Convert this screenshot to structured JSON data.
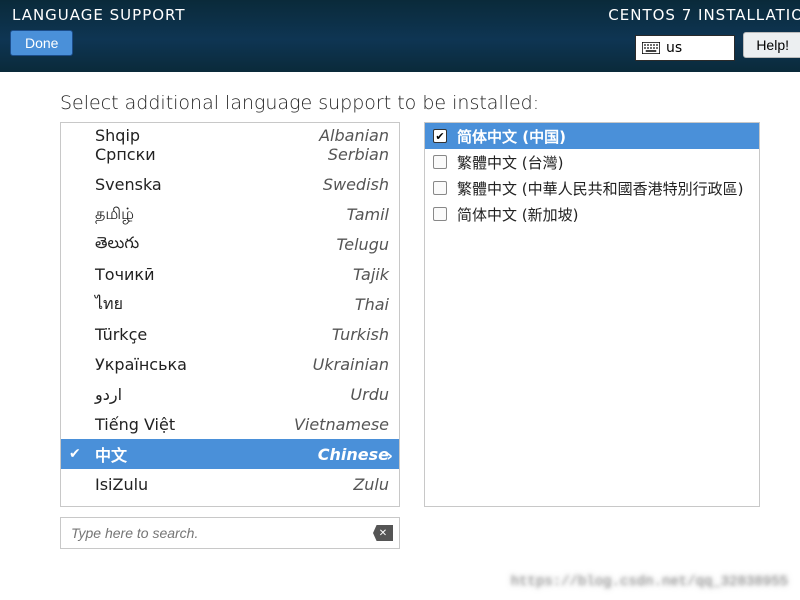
{
  "header": {
    "title_left": "LANGUAGE SUPPORT",
    "title_right": "CENTOS 7 INSTALLATIO",
    "done_label": "Done",
    "help_label": "Help!",
    "keyboard_layout": "us",
    "keyboard_icon": "keyboard-icon"
  },
  "prompt": "Select additional language support to be installed:",
  "search": {
    "placeholder": "Type here to search.",
    "clear_icon": "backspace-clear-icon",
    "value": ""
  },
  "languages_visible": [
    {
      "native": "Shqip",
      "english": "Albanian",
      "selected": false,
      "checked": false,
      "cutoff": true
    },
    {
      "native": "Српски",
      "english": "Serbian",
      "selected": false,
      "checked": false
    },
    {
      "native": "Svenska",
      "english": "Swedish",
      "selected": false,
      "checked": false
    },
    {
      "native": "தமிழ்",
      "english": "Tamil",
      "selected": false,
      "checked": false
    },
    {
      "native": "తెలుగు",
      "english": "Telugu",
      "selected": false,
      "checked": false
    },
    {
      "native": "Точикӣ",
      "english": "Tajik",
      "selected": false,
      "checked": false
    },
    {
      "native": "ไทย",
      "english": "Thai",
      "selected": false,
      "checked": false
    },
    {
      "native": "Türkçe",
      "english": "Turkish",
      "selected": false,
      "checked": false
    },
    {
      "native": "Українська",
      "english": "Ukrainian",
      "selected": false,
      "checked": false
    },
    {
      "native": "اردو",
      "english": "Urdu",
      "selected": false,
      "checked": false
    },
    {
      "native": "Tiếng Việt",
      "english": "Vietnamese",
      "selected": false,
      "checked": false
    },
    {
      "native": "中文",
      "english": "Chinese",
      "selected": true,
      "checked": true
    },
    {
      "native": "IsiZulu",
      "english": "Zulu",
      "selected": false,
      "checked": false
    }
  ],
  "locales": [
    {
      "label": "简体中文 (中国)",
      "checked": true,
      "selected": true
    },
    {
      "label": "繁體中文 (台灣)",
      "checked": false,
      "selected": false
    },
    {
      "label": "繁體中文 (中華人民共和國香港特別行政區)",
      "checked": false,
      "selected": false
    },
    {
      "label": "简体中文 (新加坡)",
      "checked": false,
      "selected": false
    }
  ],
  "watermark": "https://blog.csdn.net/qq_32838955",
  "colors": {
    "topbar_gradient_from": "#0a2a3a",
    "topbar_gradient_mid": "#0e3553",
    "accent_blue": "#4a90d9",
    "border_gray": "#c8c8c8"
  }
}
